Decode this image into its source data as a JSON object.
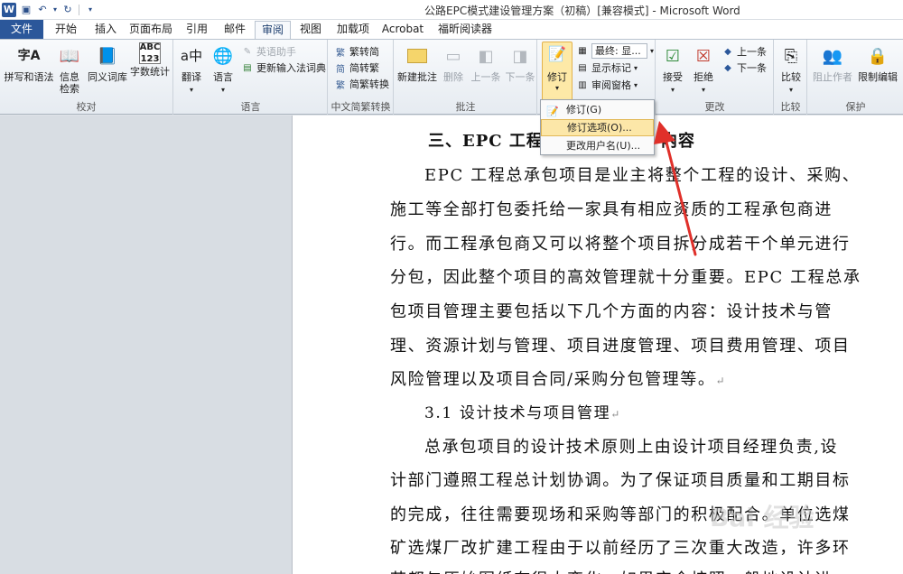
{
  "window": {
    "title": "公路EPC模式建设管理方案（初稿）[兼容模式] - Microsoft Word",
    "logo": "W"
  },
  "qat": {
    "save_icon": "save-icon",
    "undo_icon": "undo-icon",
    "redo_icon": "redo-icon"
  },
  "tabs": [
    "文件",
    "开始",
    "插入",
    "页面布局",
    "引用",
    "邮件",
    "审阅",
    "视图",
    "加载项",
    "Acrobat",
    "福昕阅读器"
  ],
  "ribbon": {
    "proofing": {
      "label": "校对",
      "spell": "拼写和语法",
      "research_line1": "信息",
      "research_line2": "检索",
      "thesaurus": "同义词库",
      "wordcount": "字数统计"
    },
    "language": {
      "label": "语言",
      "translate": "翻译",
      "language": "语言",
      "english_assistant": "英语助手",
      "update_ime": "更新输入法词典"
    },
    "chinese": {
      "label": "中文简繁转换",
      "to_trad": "繁转简",
      "to_simp": "简转繁",
      "convert": "简繁转换"
    },
    "comments": {
      "label": "批注",
      "new": "新建批注",
      "delete": "删除",
      "prev": "上一条",
      "next": "下一条"
    },
    "tracking": {
      "label": "修订",
      "track": "修订",
      "final_combo": "最终: 显...",
      "show_markup": "显示标记",
      "review_pane": "审阅窗格"
    },
    "changes": {
      "label": "更改",
      "accept": "接受",
      "reject": "拒绝",
      "prev": "上一条",
      "next": "下一条"
    },
    "compare": {
      "label": "比较",
      "compare": "比较"
    },
    "protect": {
      "label": "保护",
      "block_authors": "阻止作者",
      "restrict": "限制编辑"
    }
  },
  "dropdown": {
    "items": [
      "修订(G)",
      "修订选项(O)...",
      "更改用户名(U)..."
    ]
  },
  "document": {
    "heading": "三、EPC 工程总承包管理内容",
    "heading_visible_left": "三、EPC 工程总",
    "heading_visible_right": "内容",
    "lines": [
      "EPC 工程总承包项目是业主将整个工程的设计、采购、",
      "施工等全部打包委托给一家具有相应资质的工程承包商进",
      "行。而工程承包商又可以将整个项目拆分成若干个单元进行",
      "分包，因此整个项目的高效管理就十分重要。EPC 工程总承",
      "包项目管理主要包括以下几个方面的内容：设计技术与管",
      "理、资源计划与管理、项目进度管理、项目费用管理、项目",
      "风险管理以及项目合同/采购分包管理等。"
    ],
    "subheading": "3.1 设计技术与项目管理",
    "lines2": [
      "总承包项目的设计技术原则上由设计项目经理负责,设",
      "计部门遵照工程总计划协调。为了保证项目质量和工期目标",
      "的完成，往往需要现场和采购等部门的积极配合。单位选煤",
      "矿选煤厂改扩建工程由于以前经历了三次重大改造，许多环",
      "节都与原始图纸有很大变化，如果完全按照一般地设计进"
    ],
    "para_mark": "↵"
  },
  "watermark": "Bai 经验"
}
